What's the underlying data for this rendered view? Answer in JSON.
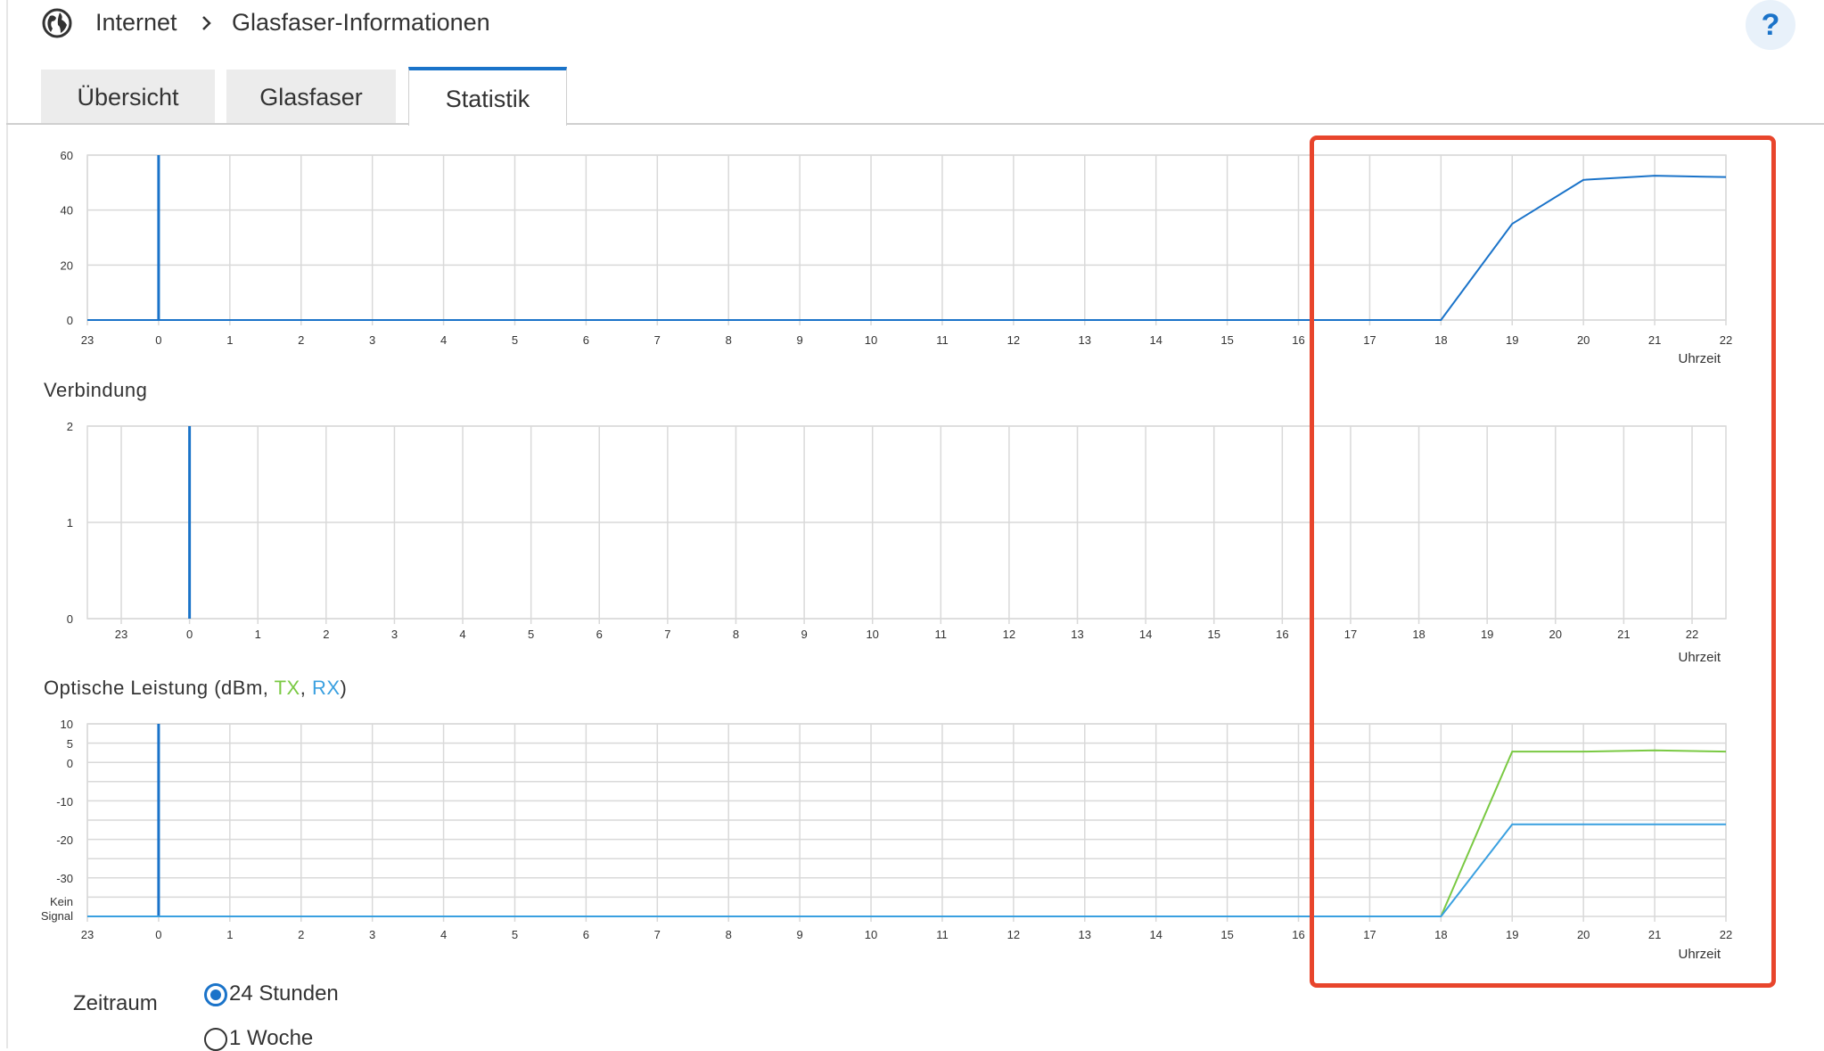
{
  "breadcrumb": {
    "section": "Internet",
    "page": "Glasfaser-Informationen"
  },
  "help_label": "?",
  "tabs": [
    {
      "label": "Übersicht",
      "active": false
    },
    {
      "label": "Glasfaser",
      "active": false
    },
    {
      "label": "Statistik",
      "active": true
    }
  ],
  "charts": {
    "verbindung_title": "Verbindung",
    "optical_title": {
      "prefix": "Optische Leistung (dBm, ",
      "tx": "TX",
      "sep": ", ",
      "rx": "RX",
      "suffix": ")"
    }
  },
  "colors": {
    "accent": "#1a73c9",
    "tx": "#7ac943",
    "rx": "#3aa0e0",
    "highlight": "#e8452c",
    "grid": "#d9d9d9"
  },
  "chart_data": [
    {
      "type": "line",
      "title": "",
      "xlabel": "Uhrzeit",
      "ylabel": "",
      "x": [
        "23",
        "0",
        "1",
        "2",
        "3",
        "4",
        "5",
        "6",
        "7",
        "8",
        "9",
        "10",
        "11",
        "12",
        "13",
        "14",
        "15",
        "16",
        "17",
        "18",
        "19",
        "20",
        "21",
        "22"
      ],
      "ylim": [
        0,
        60
      ],
      "yticks": [
        "0",
        "20",
        "40",
        "60"
      ],
      "marker_at": "0",
      "series": [
        {
          "values": [
            0,
            0,
            0,
            0,
            0,
            0,
            0,
            0,
            0,
            0,
            0,
            0,
            0,
            0,
            0,
            0,
            0,
            0,
            0,
            0,
            35,
            51,
            52.5,
            52
          ]
        }
      ]
    },
    {
      "type": "line",
      "title": "Verbindung",
      "xlabel": "Uhrzeit",
      "x": [
        "23",
        "0",
        "1",
        "2",
        "3",
        "4",
        "5",
        "6",
        "7",
        "8",
        "9",
        "10",
        "11",
        "12",
        "13",
        "14",
        "15",
        "16",
        "17",
        "18",
        "19",
        "20",
        "21",
        "22"
      ],
      "ylim": [
        0,
        2
      ],
      "yticks": [
        "0",
        "1",
        "2"
      ],
      "marker_at": "0",
      "series": []
    },
    {
      "type": "line",
      "title": "Optische Leistung (dBm, TX, RX)",
      "xlabel": "Uhrzeit",
      "x": [
        "23",
        "0",
        "1",
        "2",
        "3",
        "4",
        "5",
        "6",
        "7",
        "8",
        "9",
        "10",
        "11",
        "12",
        "13",
        "14",
        "15",
        "16",
        "17",
        "18",
        "19",
        "20",
        "21",
        "22"
      ],
      "yticks": [
        "10",
        "5",
        "0",
        "-10",
        "-20",
        "-30",
        "Kein Signal"
      ],
      "marker_at": "0",
      "series": [
        {
          "name": "TX",
          "values": [
            null,
            null,
            null,
            null,
            null,
            null,
            null,
            null,
            null,
            null,
            null,
            null,
            null,
            null,
            null,
            null,
            null,
            null,
            null,
            null,
            3,
            3,
            3.3,
            3
          ]
        },
        {
          "name": "RX",
          "values": [
            null,
            null,
            null,
            null,
            null,
            null,
            null,
            null,
            null,
            null,
            null,
            null,
            null,
            null,
            null,
            null,
            null,
            null,
            null,
            null,
            -16,
            -16,
            -16,
            -16
          ]
        }
      ]
    }
  ],
  "zeitraum": {
    "label": "Zeitraum",
    "options": [
      {
        "label": "24 Stunden",
        "checked": true
      },
      {
        "label": "1 Woche",
        "checked": false
      }
    ]
  }
}
